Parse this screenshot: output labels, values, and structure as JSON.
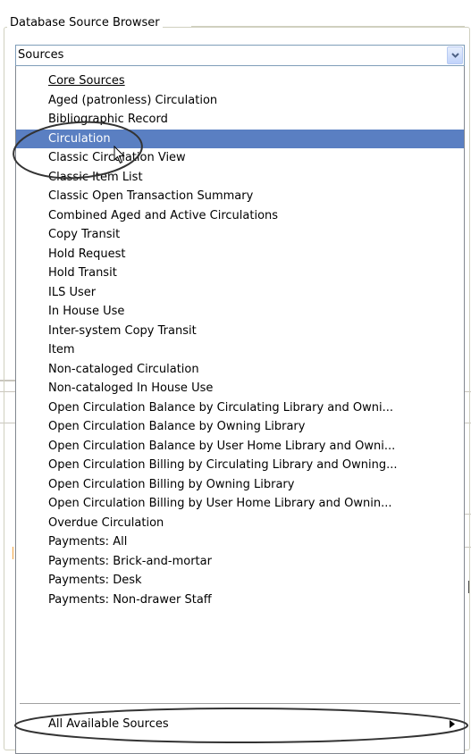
{
  "panel": {
    "legend": "Database Source Browser"
  },
  "select": {
    "value": "Sources",
    "button_icon": "chevron-down-icon"
  },
  "dropdown": {
    "header": "Core Sources",
    "items": [
      "Aged (patronless) Circulation",
      "Bibliographic Record",
      "Circulation",
      "Classic Circulation View",
      "Classic Item List",
      "Classic Open Transaction Summary",
      "Combined Aged and Active Circulations",
      "Copy Transit",
      "Hold Request",
      "Hold Transit",
      "ILS User",
      "In House Use",
      "Inter-system Copy Transit",
      "Item",
      "Non-cataloged Circulation",
      "Non-cataloged In House Use",
      "Open Circulation Balance by Circulating Library and Owni...",
      "Open Circulation Balance by Owning Library",
      "Open Circulation Balance by User Home Library and Owni...",
      "Open Circulation Billing by Circulating Library and Owning...",
      "Open Circulation Billing by Owning Library",
      "Open Circulation Billing by User Home Library and Ownin...",
      "Overdue Circulation",
      "Payments: All",
      "Payments: Brick-and-mortar",
      "Payments: Desk",
      "Payments: Non-drawer Staff"
    ],
    "selected_item": "Circulation",
    "submenu_label": "All Available Sources",
    "submenu_icon": "triangle-right-icon"
  },
  "colors": {
    "selection_background": "#5a7fc2",
    "selection_text": "#ffffff",
    "annotation_oval": "#333333",
    "border": "#7f9db9"
  }
}
